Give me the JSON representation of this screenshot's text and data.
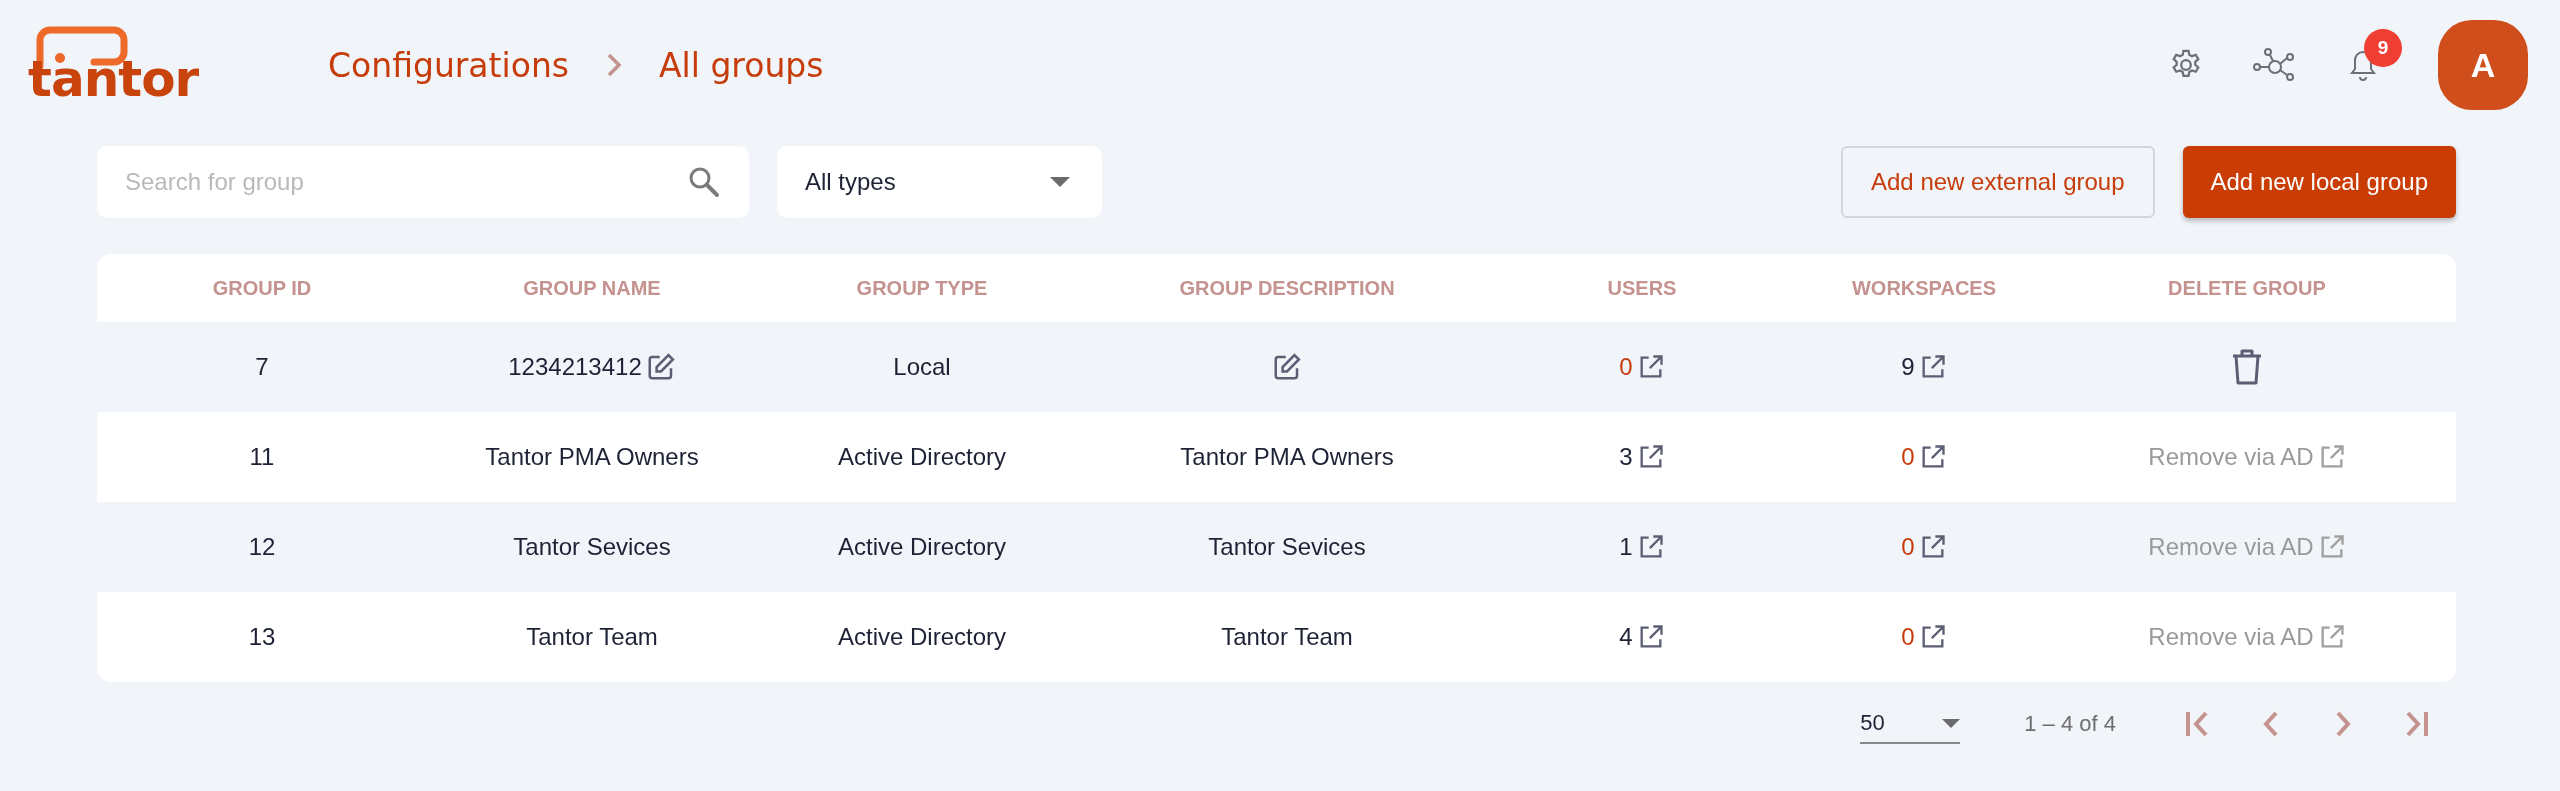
{
  "logo": {
    "text": "tantor"
  },
  "breadcrumb": [
    {
      "label": "Configurations"
    },
    {
      "label": "All groups"
    }
  ],
  "header": {
    "notifications": {
      "count": "9"
    },
    "avatar": {
      "initial": "A"
    }
  },
  "toolbar": {
    "search": {
      "placeholder": "Search for group"
    },
    "type_filter": {
      "value": "All types"
    },
    "buttons": [
      {
        "label": "Add new external group",
        "kind": "outline"
      },
      {
        "label": "Add new local group",
        "kind": "primary"
      }
    ]
  },
  "table": {
    "columns": [
      "GROUP ID",
      "GROUP NAME",
      "GROUP TYPE",
      "GROUP DESCRIPTION",
      "USERS",
      "WORKSPACES",
      "DELETE GROUP"
    ],
    "rows": [
      {
        "id": "7",
        "name": "1234213412",
        "name_editable": true,
        "type": "Local",
        "description_editable": true,
        "users": {
          "count": "0",
          "zero": true
        },
        "workspaces": {
          "count": "9",
          "zero": false
        },
        "delete": {
          "kind": "trash"
        }
      },
      {
        "id": "11",
        "name": "Tantor PMA Owners",
        "name_editable": false,
        "type": "Active Directory",
        "description": "Tantor PMA Owners",
        "description_editable": false,
        "users": {
          "count": "3",
          "zero": false
        },
        "workspaces": {
          "count": "0",
          "zero": true
        },
        "delete": {
          "kind": "external",
          "label": "Remove via AD"
        }
      },
      {
        "id": "12",
        "name": "Tantor Sevices",
        "name_editable": false,
        "type": "Active Directory",
        "description": "Tantor Sevices",
        "description_editable": false,
        "users": {
          "count": "1",
          "zero": false
        },
        "workspaces": {
          "count": "0",
          "zero": true
        },
        "delete": {
          "kind": "external",
          "label": "Remove via AD"
        }
      },
      {
        "id": "13",
        "name": "Tantor Team",
        "name_editable": false,
        "type": "Active Directory",
        "description": "Tantor Team",
        "description_editable": false,
        "users": {
          "count": "4",
          "zero": false
        },
        "workspaces": {
          "count": "0",
          "zero": true
        },
        "delete": {
          "kind": "external",
          "label": "Remove via AD"
        }
      }
    ]
  },
  "pagination": {
    "page_size": "50",
    "range": "1 – 4 of 4"
  }
}
